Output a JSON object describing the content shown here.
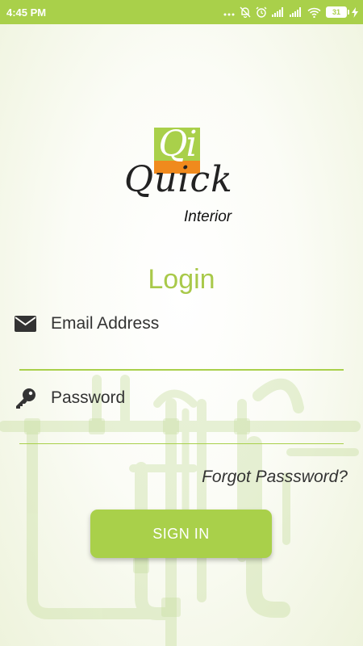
{
  "status_bar": {
    "time": "4:45 PM",
    "battery": "31",
    "icons": [
      "more-dots-icon",
      "notifications-off-icon",
      "alarm-icon",
      "signal-icon",
      "signal-icon",
      "wifi-icon",
      "battery-icon",
      "charging-icon"
    ]
  },
  "logo": {
    "monogram": "Qi",
    "name": "Quick",
    "subtitle": "Interior"
  },
  "login": {
    "title": "Login",
    "email_label": "Email Address",
    "password_label": "Password",
    "forgot_link": "Forgot Passsword?",
    "signin_label": "SIGN IN"
  },
  "colors": {
    "brand_green": "#a9d04a",
    "logo_orange": "#f08a1d",
    "text_dark": "#333333"
  }
}
